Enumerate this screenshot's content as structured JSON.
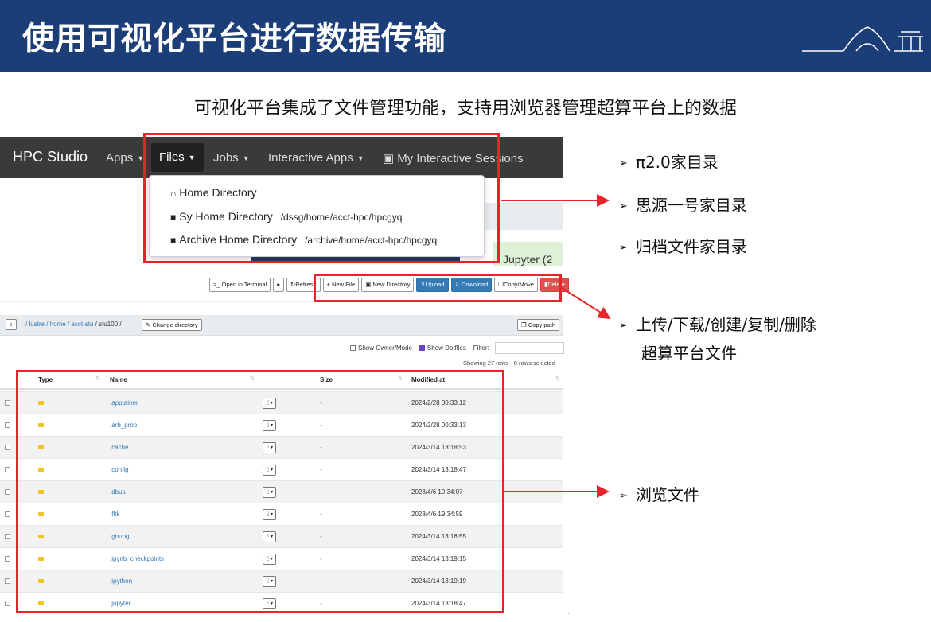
{
  "header": {
    "title": "使用可视化平台进行数据传输"
  },
  "subtitle": "可视化平台集成了文件管理功能，支持用浏览器管理超算平台上的数据",
  "navbar": {
    "brand": "HPC Studio",
    "items": [
      "Apps",
      "Files",
      "Jobs",
      "Interactive Apps",
      "My Interactive Sessions"
    ]
  },
  "files_menu": {
    "items": [
      {
        "label": "Home Directory",
        "path": ""
      },
      {
        "label": "Sy Home Directory",
        "path": "/dssg/home/acct-hpc/hpcgyq"
      },
      {
        "label": "Archive Home Directory",
        "path": "/archive/home/acct-hpc/hpcgyq"
      }
    ]
  },
  "background_fragments": {
    "interactive_apps_partial": "Interactive Apps",
    "jupyter_partial": "Jupyter (2"
  },
  "toolbar": {
    "buttons": [
      "Open in Terminal",
      "Refresh",
      "New File",
      "New Directory",
      "Upload",
      "Download",
      "Copy/Move",
      "Delete"
    ]
  },
  "pathbar": {
    "crumbs": [
      "/ lustre",
      "/ home",
      "/ acct-stu",
      "/ stu100 /"
    ],
    "change_directory": "Change directory",
    "copy_path": "Copy path"
  },
  "options": {
    "show_owner": "Show Owner/Mode",
    "show_dotfiles": "Show Dotfiles",
    "filter_label": "Filter:",
    "rows_info": "Showing 27 rows - 0 rows selected"
  },
  "table": {
    "columns": [
      "Type",
      "Name",
      "Size",
      "Modified at"
    ],
    "rows": [
      {
        "name": ".apptainer",
        "size": "-",
        "modified": "2024/2/28 00:33:12"
      },
      {
        "name": ".arb_prop",
        "size": "-",
        "modified": "2024/2/28 00:33:13"
      },
      {
        "name": ".cache",
        "size": "-",
        "modified": "2024/3/14 13:18:53"
      },
      {
        "name": ".config",
        "size": "-",
        "modified": "2024/3/14 13:18:47"
      },
      {
        "name": ".dbus",
        "size": "-",
        "modified": "2023/4/6 19:34:07"
      },
      {
        "name": ".fltk",
        "size": "-",
        "modified": "2023/4/6 19:34:59"
      },
      {
        "name": ".gnupg",
        "size": "-",
        "modified": "2024/3/14 13:16:55"
      },
      {
        "name": ".ipynb_checkpoints",
        "size": "-",
        "modified": "2024/3/14 13:19:15"
      },
      {
        "name": ".ipython",
        "size": "-",
        "modified": "2024/3/14 13:19:19"
      },
      {
        "name": ".jupyter",
        "size": "-",
        "modified": "2024/3/14 13:18:47"
      }
    ]
  },
  "bullets": {
    "b1": "π2.0家目录",
    "b2": "思源一号家目录",
    "b3": "归档文件家目录",
    "b4_line1": "上传/下载/创建/复制/删除",
    "b4_line2": "超算平台文件",
    "b5": "浏览文件"
  },
  "colors": {
    "header_bg": "#1b3d78",
    "highlight_red": "#e8232a",
    "navbar_bg": "#3a3a3a",
    "link_blue": "#337ab7"
  }
}
